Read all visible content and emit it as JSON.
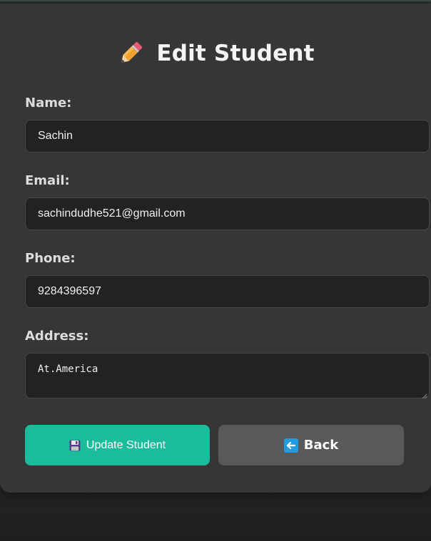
{
  "header": {
    "title": "Edit Student",
    "title_icon": "pencil-icon"
  },
  "form": {
    "name": {
      "label": "Name:",
      "value": "Sachin"
    },
    "email": {
      "label": "Email:",
      "value": "sachindudhe521@gmail.com"
    },
    "phone": {
      "label": "Phone:",
      "value": "9284396597"
    },
    "address": {
      "label": "Address:",
      "value": "At.America"
    }
  },
  "buttons": {
    "update": {
      "label": "Update Student",
      "icon": "floppy-disk-icon",
      "color": "#1bbc9b"
    },
    "back": {
      "label": "Back",
      "icon": "left-arrow-icon",
      "color": "#595959"
    }
  },
  "colors": {
    "background": "#2b2b2b",
    "card": "#363636",
    "input_bg": "#222222",
    "accent": "#1bbc9b"
  }
}
